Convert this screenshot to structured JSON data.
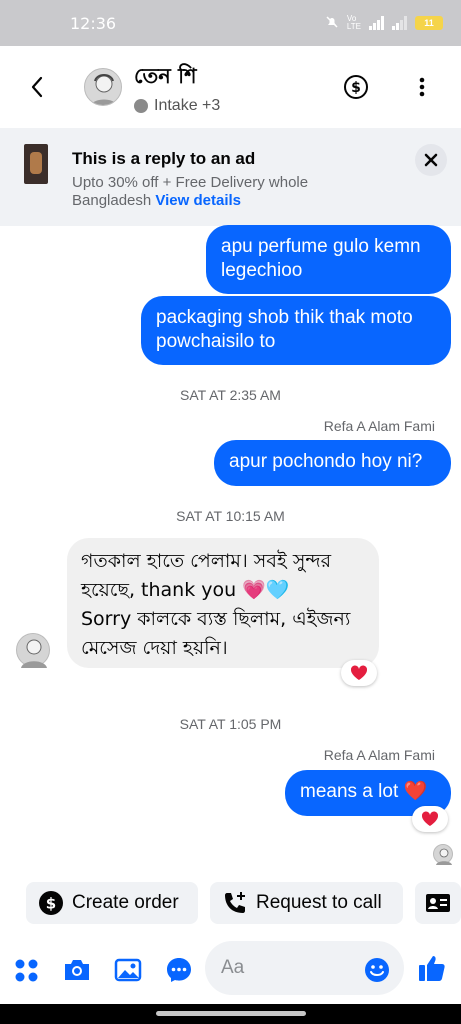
{
  "status_bar": {
    "time": "12:36",
    "battery": "11"
  },
  "header": {
    "contact_name": "তেন শি",
    "status_text": "Intake +3"
  },
  "ad": {
    "title": "This is a reply to an ad",
    "description": "Upto 30% off + Free Delivery whole Bangladesh",
    "link": "View details"
  },
  "messages": [
    {
      "type": "out",
      "text": "apu perfume gulo kemn legechioo"
    },
    {
      "type": "out",
      "text": "packaging shob thik thak moto powchaisilo to"
    },
    {
      "type": "timestamp",
      "text": "SAT AT 2:35 AM"
    },
    {
      "type": "sender",
      "text": "Refa A Alam Fami"
    },
    {
      "type": "out",
      "text": "apur pochondo hoy ni?"
    },
    {
      "type": "timestamp",
      "text": "SAT AT 10:15 AM"
    },
    {
      "type": "in",
      "line1": "গতকাল হাতে পেলাম। সবই সুন্দর",
      "line2": "হয়েছে, thank you 💗🩵",
      "line3": "Sorry কালকে ব্যস্ত ছিলাম, এইজন্য",
      "line4": "মেসেজ দেয়া হয়নি।"
    },
    {
      "type": "timestamp",
      "text": "SAT AT 1:05 PM"
    },
    {
      "type": "sender",
      "text": "Refa A Alam Fami"
    },
    {
      "type": "out",
      "text": "means a lot ❤️"
    }
  ],
  "actions": {
    "create_order": "Create order",
    "request_call": "Request to call"
  },
  "composer": {
    "placeholder": "Aa"
  },
  "colors": {
    "accent": "#0866ff",
    "heart": "#e41e3f"
  }
}
